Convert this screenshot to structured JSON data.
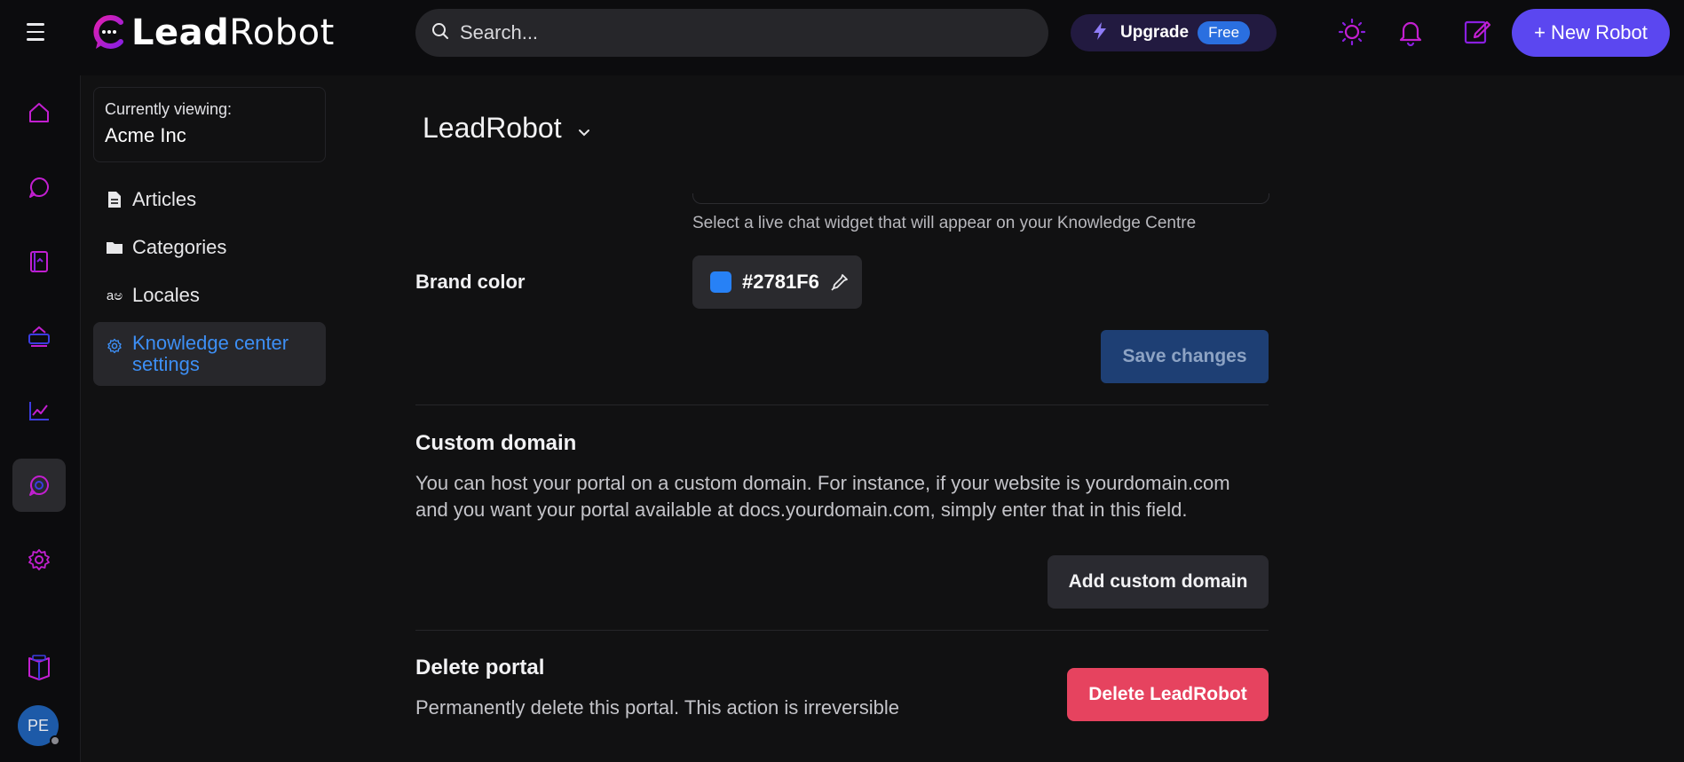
{
  "topbar": {
    "logo_text_bold": "Lead",
    "logo_text_thin": "Robot",
    "search_placeholder": "Search...",
    "upgrade_label": "Upgrade",
    "plan_badge": "Free",
    "new_robot_label": "+ New Robot"
  },
  "sidebar": {
    "viewing_label": "Currently viewing:",
    "viewing_org": "Acme Inc",
    "items": [
      {
        "label": "Articles",
        "icon": "document-icon"
      },
      {
        "label": "Categories",
        "icon": "folder-icon"
      },
      {
        "label": "Locales",
        "icon": "translate-icon"
      },
      {
        "label": "Knowledge center settings",
        "icon": "gear-icon",
        "active": true
      }
    ]
  },
  "rail": {
    "items": [
      "home-icon",
      "chat-icon",
      "book-icon",
      "robot-icon",
      "chart-icon",
      "knowledge-chat-icon",
      "settings-icon"
    ],
    "bottom_icon": "docs-book-icon",
    "avatar_initials": "PE"
  },
  "main": {
    "portal_name": "LeadRobot",
    "chat_widget_helper": "Select a live chat widget that will appear on your Knowledge Centre",
    "brand_color_label": "Brand color",
    "brand_color_value": "#2781F6",
    "save_label": "Save changes",
    "custom_domain": {
      "title": "Custom domain",
      "description": "You can host your portal on a custom domain. For instance, if your website is yourdomain.com and you want your portal available at docs.yourdomain.com, simply enter that in this field.",
      "button_label": "Add custom domain"
    },
    "delete_portal": {
      "title": "Delete portal",
      "description": "Permanently delete this portal. This action is irreversible",
      "button_label": "Delete LeadRobot"
    }
  },
  "colors": {
    "accent_purple": "#5b47f0",
    "link_blue": "#3d8ff5",
    "danger": "#e6435f",
    "brand_color": "#2781F6",
    "icon_magenta": "#c21fd0"
  }
}
